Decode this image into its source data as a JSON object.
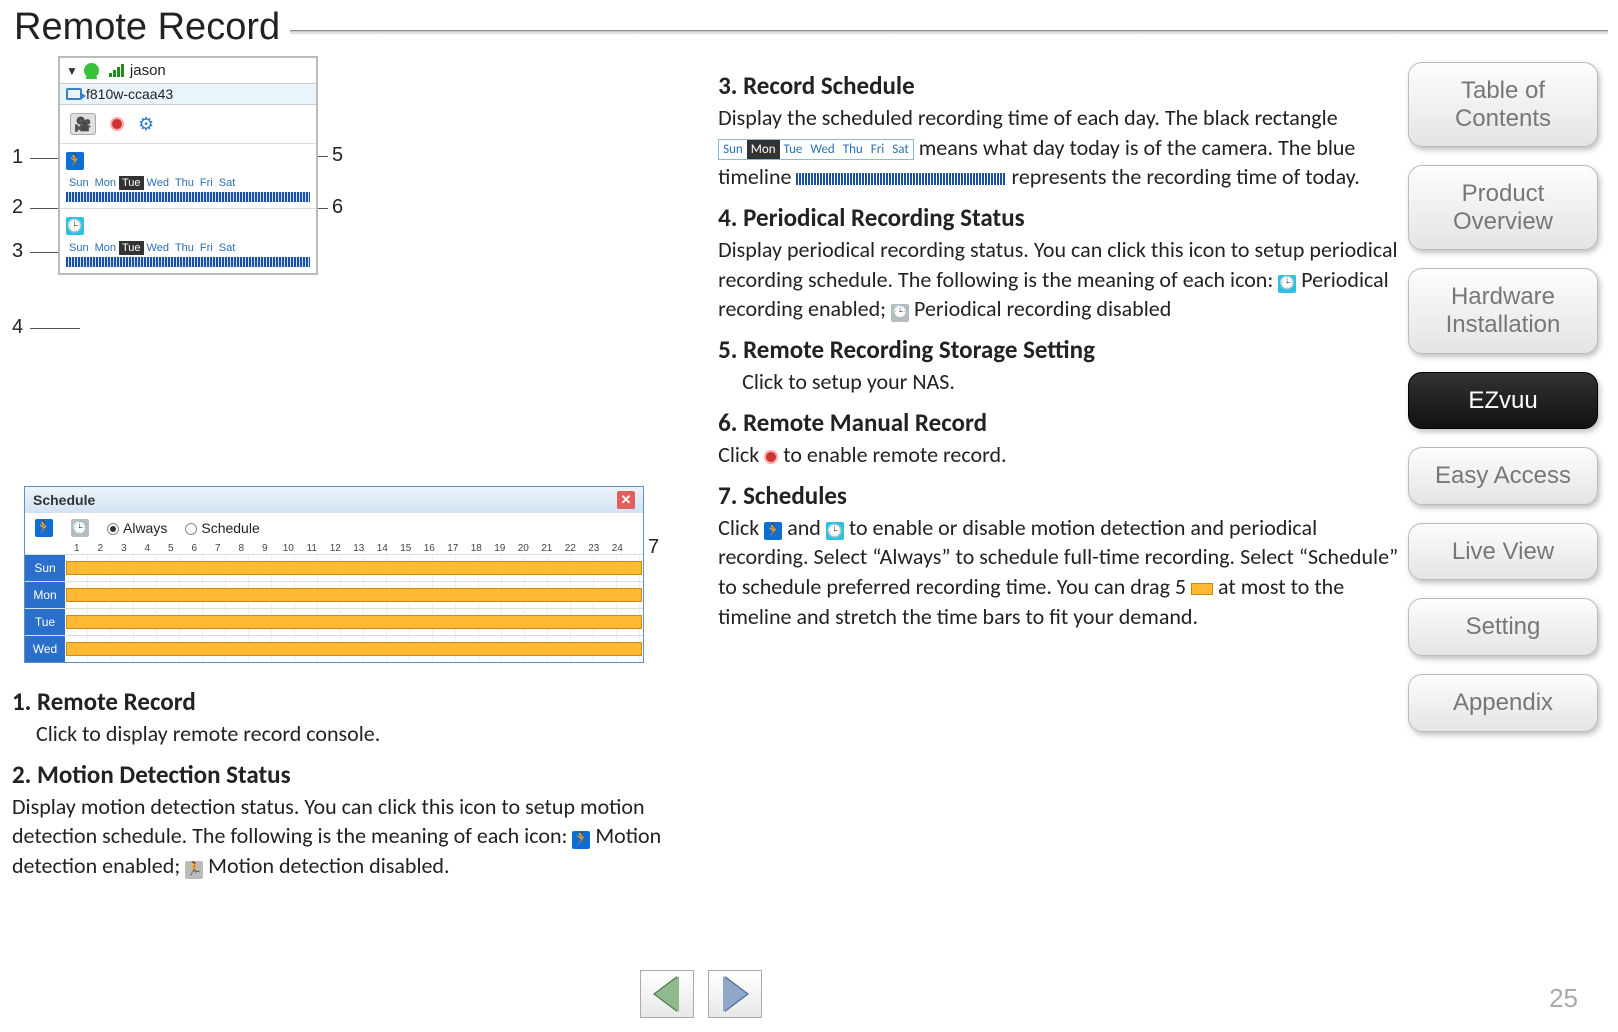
{
  "page_title": "Remote Record",
  "page_number": "25",
  "console": {
    "user_name": "jason",
    "device_id": "f810w-ccaa43",
    "days": [
      "Sun",
      "Mon",
      "Tue",
      "Wed",
      "Thu",
      "Fri",
      "Sat"
    ],
    "today_index": 2
  },
  "callouts": {
    "1": "1",
    "2": "2",
    "3": "3",
    "4": "4",
    "5": "5",
    "6": "6",
    "7": "7"
  },
  "schedule_panel": {
    "title": "Schedule",
    "mode_always": "Always",
    "mode_schedule": "Schedule",
    "days": [
      "Sun",
      "Mon",
      "Tue",
      "Wed"
    ],
    "hours": [
      "1",
      "2",
      "3",
      "4",
      "5",
      "6",
      "7",
      "8",
      "9",
      "10",
      "11",
      "12",
      "13",
      "14",
      "15",
      "16",
      "17",
      "18",
      "19",
      "20",
      "21",
      "22",
      "23",
      "24"
    ]
  },
  "left_sections": {
    "s1_title": "1. Remote Record",
    "s1_body": "Click to display remote record console.",
    "s2_title": "2. Motion Detection  Status",
    "s2_body_a": "Display motion detection status. You can click this icon to setup motion detection schedule. The following is the meaning of each icon:",
    "s2_body_b": "Motion detection enabled;",
    "s2_body_c": "Motion detection disabled."
  },
  "right_sections": {
    "s3_title": "3. Record Schedule",
    "s3_a": "Display the scheduled recording time of each day. The black rectangle ",
    "s3_b": " means what day today is of the camera. The blue timeline ",
    "s3_c": " represents the recording time of today.",
    "s4_title": "4. Periodical Recording Status",
    "s4_a": "Display periodical recording status. You can click this icon to setup periodical recording schedule. The following is the meaning of each icon: ",
    "s4_b": " Periodical recording enabled;",
    "s4_c": "Periodical recording disabled",
    "s5_title": "5. Remote Recording Storage Setting",
    "s5_a": "Click to setup your NAS.",
    "s6_title": "6. Remote Manual Record",
    "s6_a": "Click ",
    "s6_b": " to enable remote record.",
    "s7_title": "7. Schedules",
    "s7_a": "Click ",
    "s7_b": " and ",
    "s7_c": " to enable or disable motion detection and periodical recording. Select “Always” to schedule full-time recording. Select “Schedule” to schedule preferred recording time. You can drag 5 ",
    "s7_d": " at most to the timeline and stretch the time bars to fit your demand."
  },
  "nav": {
    "toc": "Table of Contents",
    "product": "Product Overview",
    "hardware": "Hardware Installation",
    "ezvuu": "EZvuu",
    "easy": "Easy Access",
    "live": "Live View",
    "setting": "Setting",
    "appendix": "Appendix"
  }
}
